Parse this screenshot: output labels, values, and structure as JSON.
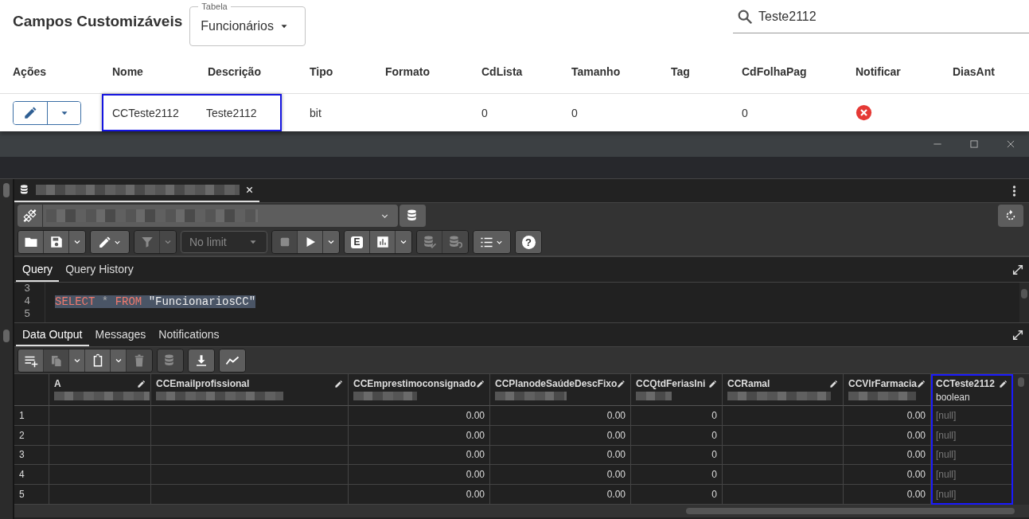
{
  "web": {
    "title": "Campos Customizáveis",
    "table_select": {
      "label": "Tabela",
      "value": "Funcionários"
    },
    "search": {
      "value": "Teste2112"
    },
    "columns": [
      "Ações",
      "Nome",
      "Descrição",
      "Tipo",
      "Formato",
      "CdLista",
      "Tamanho",
      "Tag",
      "CdFolhaPag",
      "Notificar",
      "DiasAnt"
    ],
    "rows": [
      {
        "cells": [
          {
            "kind": "actions"
          },
          {
            "kind": "text",
            "text": "CCTeste2112",
            "highlighted": true
          },
          {
            "kind": "text",
            "text": "Teste2112",
            "highlighted": true
          },
          {
            "kind": "text",
            "text": "bit",
            "highlighted": false
          },
          {
            "kind": "empty"
          },
          {
            "kind": "text",
            "text": "0",
            "highlighted": false
          },
          {
            "kind": "text",
            "text": "0",
            "highlighted": false
          },
          {
            "kind": "empty"
          },
          {
            "kind": "text",
            "text": "0",
            "highlighted": false
          },
          {
            "kind": "flag",
            "value": false
          },
          {
            "kind": "empty"
          }
        ]
      }
    ]
  },
  "pg": {
    "toolbar": [
      [
        {
          "kind": "folder",
          "disabled": false
        },
        {
          "kind": "save",
          "disabled": false
        },
        {
          "kind": "caret",
          "disabled": false
        }
      ],
      [
        {
          "kind": "edit-menu",
          "disabled": false
        }
      ],
      [
        {
          "kind": "filter",
          "disabled": true
        },
        {
          "kind": "caret",
          "disabled": true
        }
      ],
      [
        {
          "kind": "limit",
          "value": "No limit",
          "disabled": true
        }
      ],
      [
        {
          "kind": "stop",
          "disabled": true
        },
        {
          "kind": "play",
          "disabled": false
        },
        {
          "kind": "caret",
          "disabled": false
        }
      ],
      [
        {
          "kind": "explain",
          "label": "E",
          "disabled": false
        },
        {
          "kind": "chart",
          "disabled": false
        },
        {
          "kind": "caret",
          "disabled": false
        }
      ],
      [
        {
          "kind": "db-check",
          "disabled": true
        },
        {
          "kind": "db-undo",
          "disabled": true
        }
      ],
      [
        {
          "kind": "list-menu",
          "disabled": false
        }
      ],
      [
        {
          "kind": "help",
          "label": "?",
          "disabled": false
        }
      ]
    ],
    "query_tabs": [
      {
        "label": "Query",
        "selected": true
      },
      {
        "label": "Query History",
        "selected": false
      }
    ],
    "editor": {
      "lines": [
        {
          "number": "3"
        },
        {
          "number": "4",
          "selected": true,
          "tokens": [
            {
              "kind": "keyword",
              "text": "SELECT"
            },
            {
              "kind": "operator",
              "text": " * "
            },
            {
              "kind": "keyword",
              "text": "FROM"
            },
            {
              "kind": "string",
              "text": " \"FuncionariosCC\""
            }
          ]
        },
        {
          "number": "5"
        }
      ]
    },
    "output_tabs": [
      {
        "label": "Data Output",
        "selected": true
      },
      {
        "label": "Messages",
        "selected": false
      },
      {
        "label": "Notifications",
        "selected": false
      }
    ],
    "output_toolbar": [
      [
        {
          "kind": "add-row",
          "disabled": false
        },
        {
          "kind": "copy",
          "disabled": true
        },
        {
          "kind": "caret",
          "disabled": false
        },
        {
          "kind": "paste",
          "disabled": false
        },
        {
          "kind": "caret",
          "disabled": false
        },
        {
          "kind": "delete",
          "disabled": true
        }
      ],
      [
        {
          "kind": "db-save",
          "disabled": true
        }
      ],
      [
        {
          "kind": "download",
          "disabled": false
        }
      ],
      [
        {
          "kind": "graph",
          "disabled": false
        }
      ]
    ],
    "grid": {
      "columns": [
        {
          "name": "A",
          "highlighted": false
        },
        {
          "name": "CCEmailprofissional",
          "highlighted": false
        },
        {
          "name": "CCEmprestimoconsignado",
          "highlighted": false
        },
        {
          "name": "CCPlanodeSaúdeDescFixo",
          "highlighted": false
        },
        {
          "name": "CCQtdFeriasIni",
          "highlighted": false
        },
        {
          "name": "CCRamal",
          "highlighted": false
        },
        {
          "name": "CCVlrFarmacia",
          "highlighted": false
        },
        {
          "name": "CCTeste2112",
          "type": "boolean",
          "highlighted": true
        }
      ],
      "rows": [
        {
          "number": "1",
          "cells": [
            {
              "kind": "empty"
            },
            {
              "kind": "empty"
            },
            {
              "kind": "number",
              "text": "0.00"
            },
            {
              "kind": "number",
              "text": "0.00"
            },
            {
              "kind": "number",
              "text": "0"
            },
            {
              "kind": "empty"
            },
            {
              "kind": "number",
              "text": "0.00"
            },
            {
              "kind": "null",
              "text": "[null]"
            }
          ]
        },
        {
          "number": "2",
          "cells": [
            {
              "kind": "empty"
            },
            {
              "kind": "empty"
            },
            {
              "kind": "number",
              "text": "0.00"
            },
            {
              "kind": "number",
              "text": "0.00"
            },
            {
              "kind": "number",
              "text": "0"
            },
            {
              "kind": "empty"
            },
            {
              "kind": "number",
              "text": "0.00"
            },
            {
              "kind": "null",
              "text": "[null]"
            }
          ]
        },
        {
          "number": "3",
          "cells": [
            {
              "kind": "empty"
            },
            {
              "kind": "empty"
            },
            {
              "kind": "number",
              "text": "0.00"
            },
            {
              "kind": "number",
              "text": "0.00"
            },
            {
              "kind": "number",
              "text": "0"
            },
            {
              "kind": "empty"
            },
            {
              "kind": "number",
              "text": "0.00"
            },
            {
              "kind": "null",
              "text": "[null]"
            }
          ]
        },
        {
          "number": "4",
          "cells": [
            {
              "kind": "empty"
            },
            {
              "kind": "empty"
            },
            {
              "kind": "number",
              "text": "0.00"
            },
            {
              "kind": "number",
              "text": "0.00"
            },
            {
              "kind": "number",
              "text": "0"
            },
            {
              "kind": "empty"
            },
            {
              "kind": "number",
              "text": "0.00"
            },
            {
              "kind": "null",
              "text": "[null]"
            }
          ]
        },
        {
          "number": "5",
          "cells": [
            {
              "kind": "empty"
            },
            {
              "kind": "empty"
            },
            {
              "kind": "number",
              "text": "0.00"
            },
            {
              "kind": "number",
              "text": "0.00"
            },
            {
              "kind": "number",
              "text": "0"
            },
            {
              "kind": "empty"
            },
            {
              "kind": "number",
              "text": "0.00"
            },
            {
              "kind": "null",
              "text": "[null]"
            }
          ]
        }
      ]
    }
  }
}
